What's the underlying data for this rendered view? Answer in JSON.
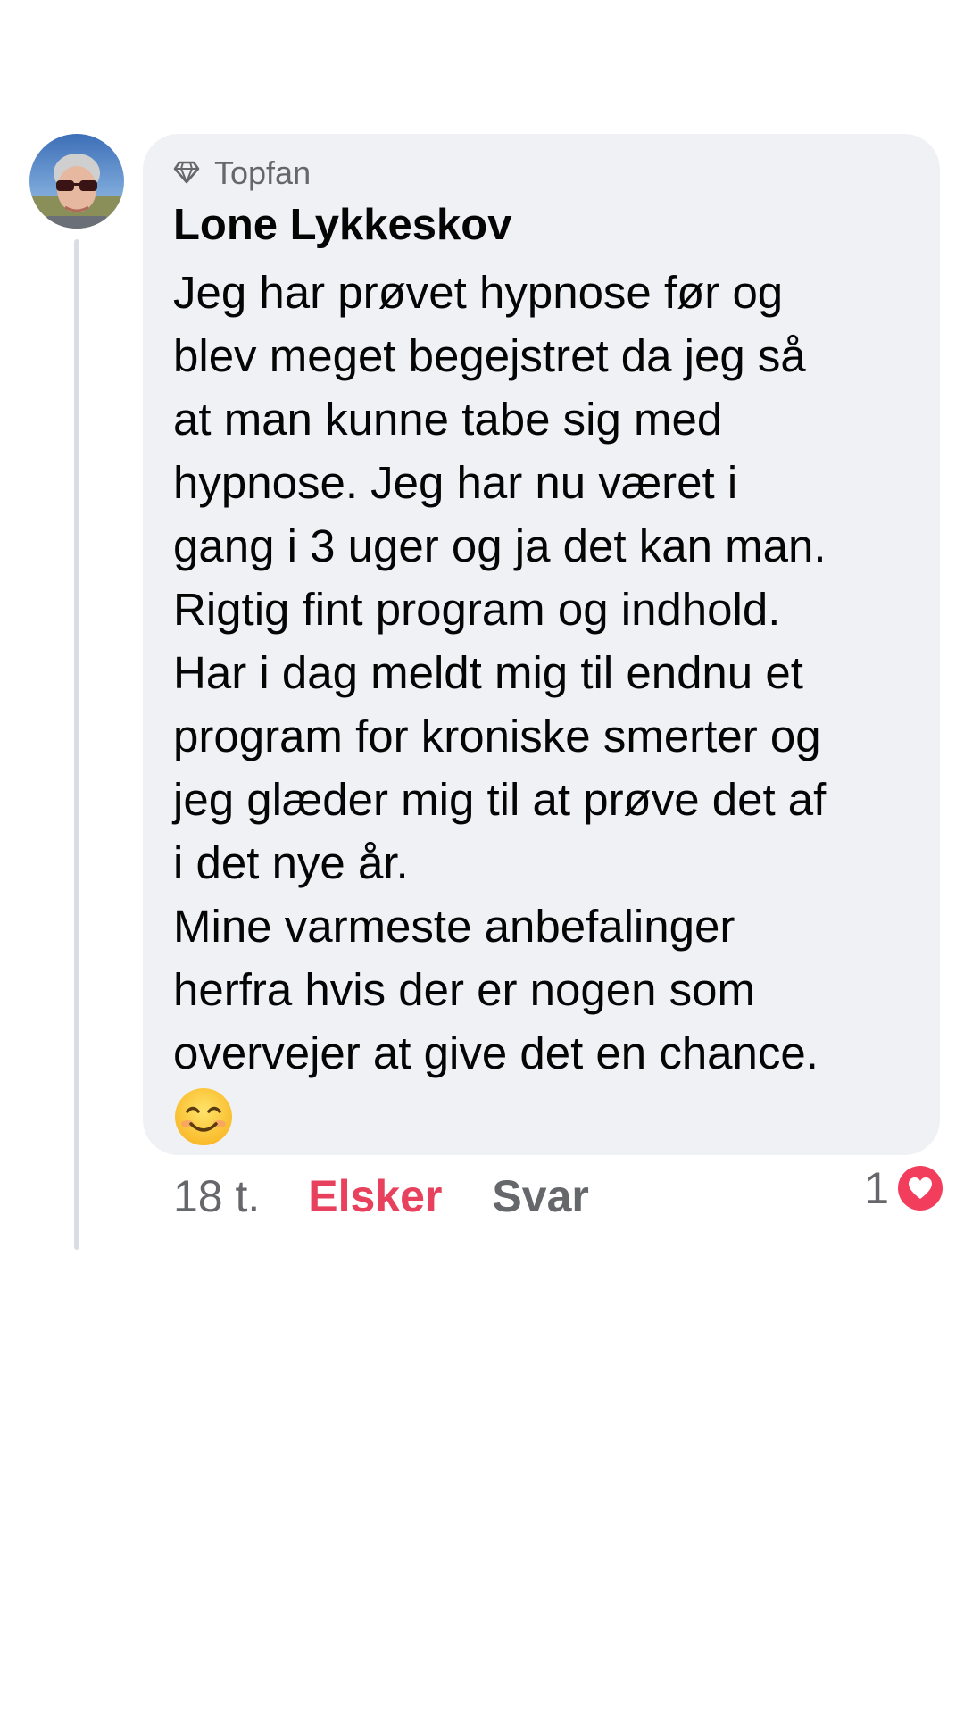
{
  "comment": {
    "badge_label": "Topfan",
    "badge_icon": "diamond-icon",
    "author": "Lone Lykkeskov",
    "text": "Jeg har prøvet hypnose før og\nblev meget begejstret da jeg så\nat man kunne tabe sig med\nhypnose. Jeg har nu været i\ngang i 3 uger og ja det kan man.\nRigtig fint program og indhold.\nHar i dag meldt mig til endnu et\nprogram for kroniske smerter og\njeg glæder mig til at prøve det af\ni det nye år.\nMine varmeste anbefalinger\nherfra hvis der er nogen som\novervejer at give det en chance.",
    "emoji": "smiling-face-emoji"
  },
  "actions": {
    "time": "18 t.",
    "love_label": "Elsker",
    "reply_label": "Svar"
  },
  "reactions": {
    "count": "1",
    "type": "heart-icon"
  },
  "colors": {
    "bubble": "#f0f1f5",
    "love": "#e8415d",
    "heart": "#f23e5c",
    "secondary_text": "#65676b"
  }
}
